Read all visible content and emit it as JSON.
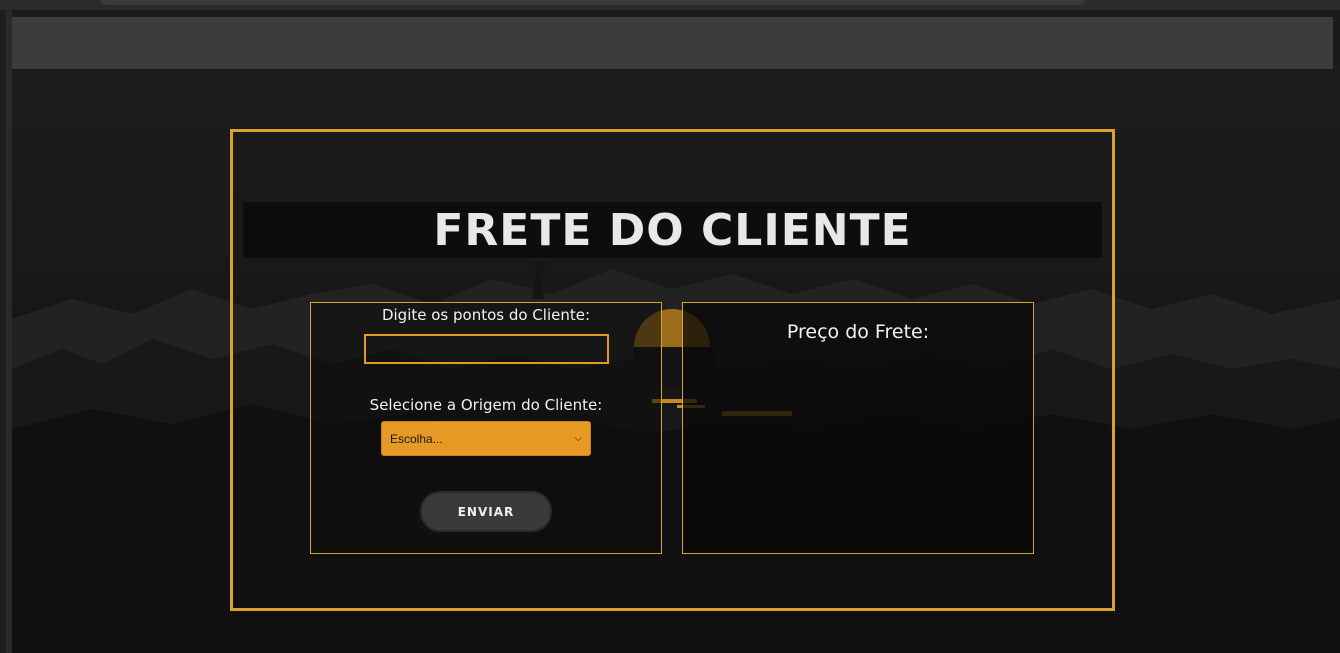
{
  "page": {
    "title": "FRETE DO CLIENTE"
  },
  "form": {
    "points_label": "Digite os pontos do Cliente:",
    "points_value": "",
    "origin_label": "Selecione a Origem do Cliente:",
    "origin_selected": "Escolha...",
    "submit_label": "ENVIAR"
  },
  "result": {
    "price_label": "Preço do Frete:"
  },
  "colors": {
    "accent": "#d9a22d",
    "select_bg": "#e69a23",
    "background": "#1b1b1b"
  }
}
